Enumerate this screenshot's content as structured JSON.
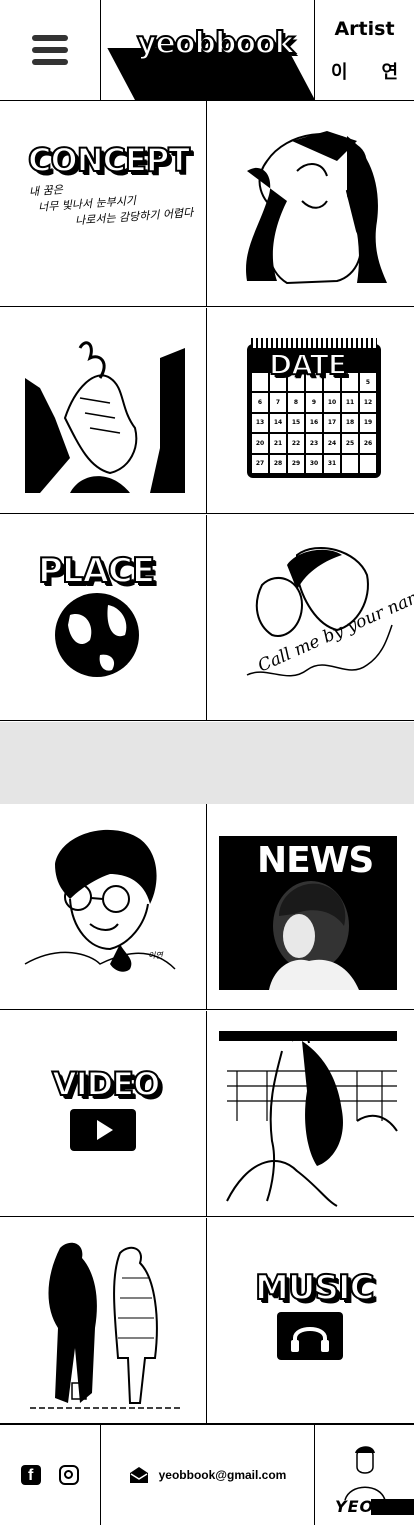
{
  "header": {
    "logo": "yeobbook",
    "artist_label": "Artist",
    "artist_name_1": "이",
    "artist_name_2": "연"
  },
  "tiles": {
    "concept": "CONCEPT",
    "concept_note_1": "내 꿈은",
    "concept_note_2": "너무 빛나서 눈부시기",
    "concept_note_3": "나로서는 감당하기 어렵다",
    "date": "DATE",
    "calendar_days": [
      "",
      "",
      "",
      "",
      "",
      "",
      "5",
      "6",
      "7",
      "8",
      "9",
      "10",
      "11",
      "12",
      "13",
      "14",
      "15",
      "16",
      "17",
      "18",
      "19",
      "20",
      "21",
      "22",
      "23",
      "24",
      "25",
      "26",
      "27",
      "28",
      "29",
      "30",
      "31",
      "",
      ""
    ],
    "place": "PLACE",
    "call_script": "Call me by your name",
    "portrait_signature": "이연",
    "news": "NEWS",
    "video": "VIDEO",
    "music": "MUSIC"
  },
  "footer": {
    "email": "yeobbook@gmail.com",
    "avatar_logo": "YEO"
  }
}
